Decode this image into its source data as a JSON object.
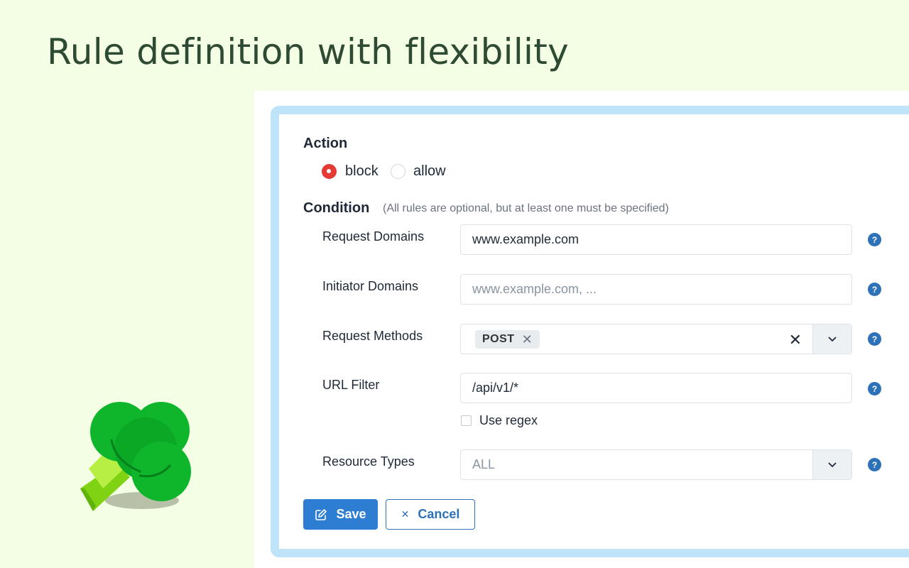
{
  "page_title": "Rule definition with flexibility",
  "action": {
    "title": "Action",
    "options": [
      {
        "label": "block",
        "checked": true
      },
      {
        "label": "allow",
        "checked": false
      }
    ]
  },
  "condition": {
    "title": "Condition",
    "hint": "(All rules are optional, but at least one must be specified)",
    "fields": {
      "request_domains": {
        "label": "Request Domains",
        "value": "www.example.com"
      },
      "initiator_domains": {
        "label": "Initiator Domains",
        "placeholder": "www.example.com, ..."
      },
      "request_methods": {
        "label": "Request Methods",
        "tags": [
          "POST"
        ]
      },
      "url_filter": {
        "label": "URL Filter",
        "value": "/api/v1/*",
        "regex_label": "Use regex",
        "regex_checked": false
      },
      "resource_types": {
        "label": "Resource Types",
        "placeholder": "ALL"
      }
    },
    "help_glyph": "?"
  },
  "buttons": {
    "save": "Save",
    "cancel": "Cancel"
  },
  "colors": {
    "background": "#f3fee4",
    "card_border": "#bfe3f8",
    "primary": "#2d7dd2",
    "radio_checked": "#e53935"
  }
}
